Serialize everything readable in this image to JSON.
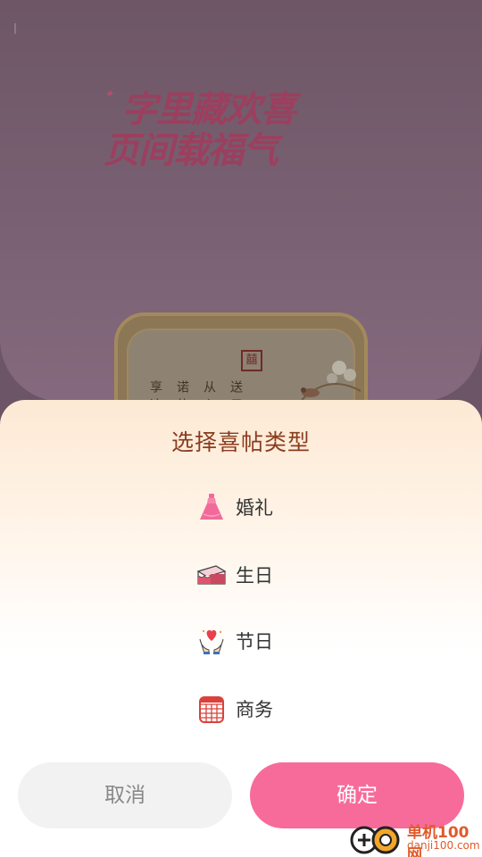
{
  "background": {
    "title_line1": "字里藏欢喜",
    "title_line2": "页间载福气",
    "card": {
      "seal_text": "囍",
      "poem_columns": [
        "享这",
        "诺的",
        "从心",
        "送只"
      ]
    }
  },
  "sheet": {
    "title": "选择喜帖类型",
    "options": [
      {
        "label": "婚礼",
        "icon": "wedding-dress-icon"
      },
      {
        "label": "生日",
        "icon": "birthday-cake-icon"
      },
      {
        "label": "节日",
        "icon": "heart-hands-icon"
      },
      {
        "label": "商务",
        "icon": "calendar-icon"
      }
    ],
    "cancel_label": "取消",
    "confirm_label": "确定"
  },
  "watermark": {
    "text1": "单机100网",
    "text2": "danji100.com"
  },
  "colors": {
    "accent": "#f76b9a",
    "title_brown": "#8a3c1e",
    "cancel_bg": "#f2f2f2"
  }
}
